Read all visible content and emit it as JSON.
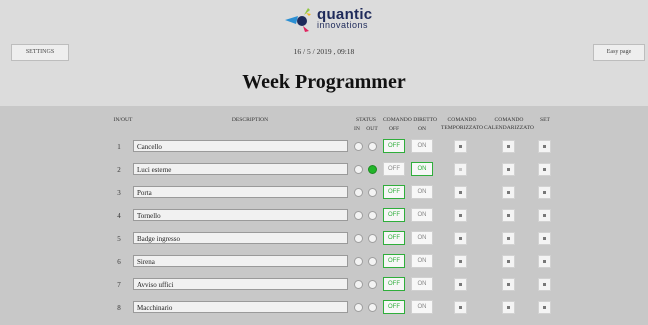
{
  "brand": {
    "line1": "quantic",
    "line2": "innovations"
  },
  "toolbar": {
    "settings_label": "SETTINGS",
    "easy_label": "Easy page"
  },
  "datetime": "16 / 5 / 2019 , 09:18",
  "title": "Week Programmer",
  "headers": {
    "inout": "IN/OUT",
    "description": "DESCRIPTION",
    "status": "STATUS",
    "status_in": "IN",
    "status_out": "OUT",
    "comando_diretto": "COMANDO DIRETTO",
    "off": "OFF",
    "on": "ON",
    "comando_temporizzato": "COMANDO TEMPORIZZATO",
    "comando_calendarizzato": "COMANDO CALENDARIZZATO",
    "set": "SET"
  },
  "colors": {
    "active_green": "#2fae3b",
    "led_on": "#22b52a",
    "header_bg": "#dcdcdc",
    "body_bg": "#c8c8c8"
  },
  "rows": [
    {
      "num": "1",
      "description": "Cancello",
      "in": false,
      "out": false,
      "active": "off",
      "timer_enabled": true
    },
    {
      "num": "2",
      "description": "Luci esterne",
      "in": false,
      "out": true,
      "active": "on",
      "timer_enabled": false
    },
    {
      "num": "3",
      "description": "Porta",
      "in": false,
      "out": false,
      "active": "off",
      "timer_enabled": true
    },
    {
      "num": "4",
      "description": "Tornello",
      "in": false,
      "out": false,
      "active": "off",
      "timer_enabled": true
    },
    {
      "num": "5",
      "description": "Badge ingresso",
      "in": false,
      "out": false,
      "active": "off",
      "timer_enabled": true
    },
    {
      "num": "6",
      "description": "Sirena",
      "in": false,
      "out": false,
      "active": "off",
      "timer_enabled": true
    },
    {
      "num": "7",
      "description": "Avviso uffici",
      "in": false,
      "out": false,
      "active": "off",
      "timer_enabled": true
    },
    {
      "num": "8",
      "description": "Macchinario",
      "in": false,
      "out": false,
      "active": "off",
      "timer_enabled": true
    }
  ]
}
